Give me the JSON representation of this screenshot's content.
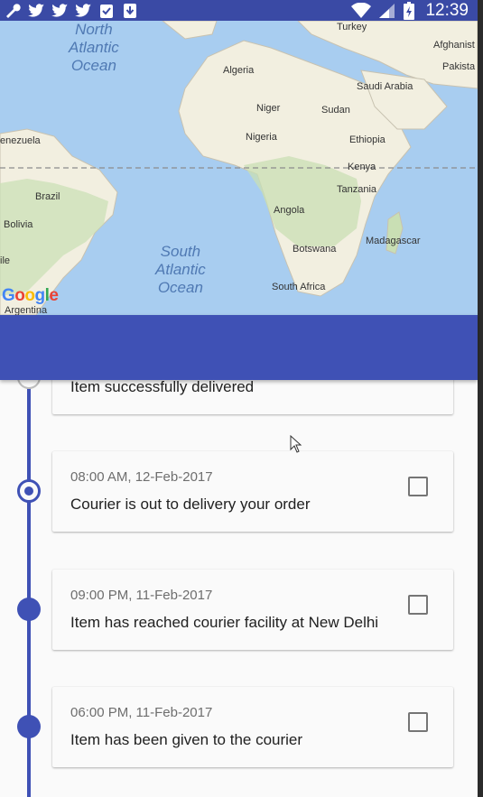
{
  "status_bar": {
    "time": "12:39",
    "left_icons": [
      "wrench-icon",
      "twitter-icon",
      "twitter-icon",
      "twitter-icon",
      "clipboard-check-icon",
      "download-icon"
    ],
    "right_icons": [
      "wifi-icon",
      "signal-icon",
      "battery-icon"
    ]
  },
  "map": {
    "oceans": {
      "north_atlantic": "North\nAtlantic\nOcean",
      "south_atlantic": "South\nAtlantic\nOcean"
    },
    "countries": {
      "turkey": "Turkey",
      "afghanistan": "Afghanist",
      "pakistan": "Pakista",
      "algeria": "Algeria",
      "saudi_arabia": "Saudi Arabia",
      "niger": "Niger",
      "sudan": "Sudan",
      "venezuela": "enezuela",
      "nigeria": "Nigeria",
      "ethiopia": "Ethiopia",
      "kenya": "Kenya",
      "brazil": "Brazil",
      "tanzania": "Tanzania",
      "angola": "Angola",
      "bolivia": "Bolivia",
      "madagascar": "Madagascar",
      "botswana": "Botswana",
      "chile": "ile",
      "south_africa": "South Africa",
      "argentina": "Argentina"
    },
    "attribution": [
      "G",
      "o",
      "o",
      "g",
      "l",
      "e"
    ]
  },
  "timeline": {
    "items": [
      {
        "time": "",
        "message": "Item successfully delivered",
        "status": "done",
        "checked": false
      },
      {
        "time": "08:00 AM, 12-Feb-2017",
        "message": "Courier is out to delivery your order",
        "status": "current",
        "checked": false
      },
      {
        "time": "09:00 PM, 11-Feb-2017",
        "message": "Item has reached courier facility at New Delhi",
        "status": "completed",
        "checked": false
      },
      {
        "time": "06:00 PM, 11-Feb-2017",
        "message": "Item has been given to the courier",
        "status": "completed",
        "checked": false
      }
    ]
  },
  "colors": {
    "primary": "#3f51b5",
    "status_bar": "#3a4aa5",
    "ocean": "#a8cdf0",
    "land": "#f2efe0"
  }
}
